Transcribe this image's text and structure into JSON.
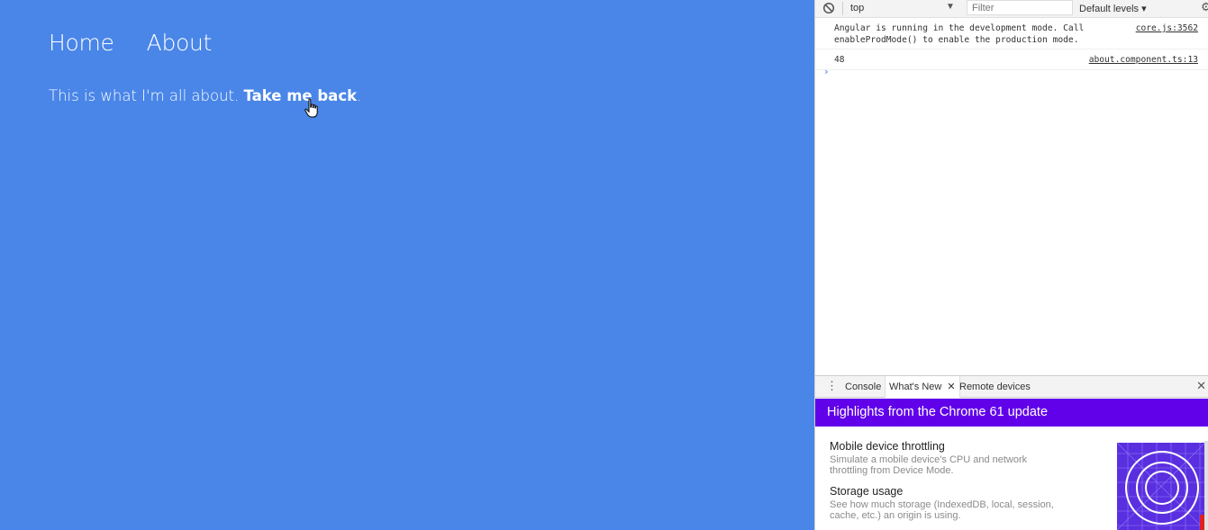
{
  "app": {
    "nav": {
      "home": "Home",
      "about": "About"
    },
    "about_text": "This is what I'm all about. ",
    "back_link": "Take me back",
    "about_end": "."
  },
  "devtools": {
    "toolbar": {
      "context": "top",
      "filter_placeholder": "Filter",
      "levels": "Default levels"
    },
    "messages": [
      {
        "line1": "Angular is running in the development mode. Call",
        "line2": "enableProdMode() to enable the production mode.",
        "source": "core.js:3562"
      },
      {
        "line1": "48",
        "source": "about.component.ts:13"
      }
    ],
    "prompt": "›",
    "drawer": {
      "tabs": [
        "Console",
        "What's New",
        "Remote devices"
      ],
      "active_tab": "What's New"
    },
    "whats_new": {
      "banner": "Highlights from the Chrome 61 update",
      "features": [
        {
          "title": "Mobile device throttling",
          "desc1": "Simulate a mobile device's CPU and network",
          "desc2": "throttling from Device Mode."
        },
        {
          "title": "Storage usage",
          "desc1": "See how much storage (IndexedDB, local, session,",
          "desc2": "cache, etc.) an origin is using."
        }
      ]
    }
  },
  "colors": {
    "app_bg": "#4a86e8",
    "banner_bg": "#6001ea",
    "prompt": "#367cf1"
  }
}
